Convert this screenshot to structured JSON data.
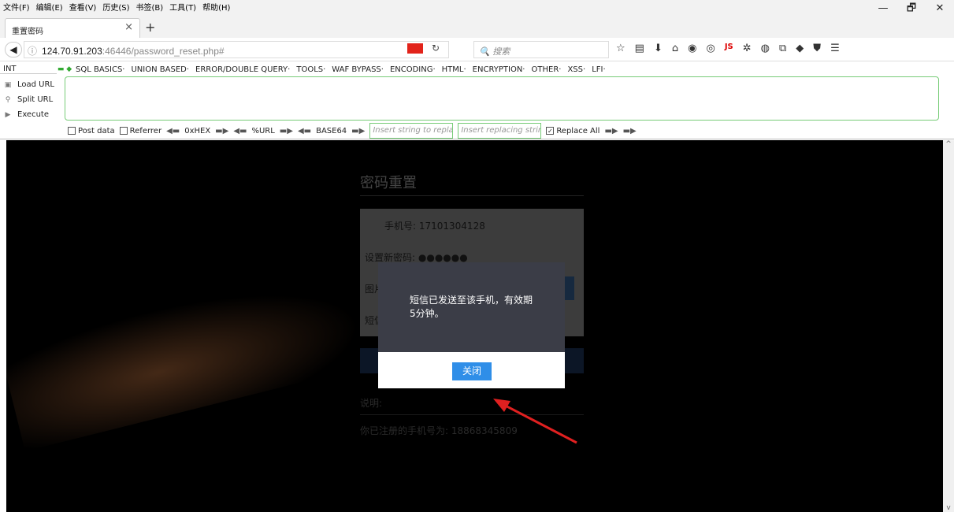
{
  "menubar": {
    "items": [
      "文件(F)",
      "编辑(E)",
      "查看(V)",
      "历史(S)",
      "书签(B)",
      "工具(T)",
      "帮助(H)"
    ],
    "window_controls": {
      "minimize": "—",
      "restore": "🗗",
      "close": "✕"
    }
  },
  "tabbar": {
    "tab_title": "重置密码",
    "close_glyph": "×",
    "new_tab_glyph": "+"
  },
  "navbar": {
    "url_host": "124.70.91.203",
    "url_port_path": ":46446/password_reset.php#",
    "search_placeholder": "搜索",
    "js_label": "JS"
  },
  "hackbar": {
    "select_value": "INT",
    "menu": [
      "SQL BASICS·",
      "UNION BASED·",
      "ERROR/DOUBLE QUERY·",
      "TOOLS·",
      "WAF BYPASS·",
      "ENCODING·",
      "HTML·",
      "ENCRYPTION·",
      "OTHER·",
      "XSS·",
      "LFI·"
    ],
    "side": {
      "load_url": "Load URL",
      "split_url": "Split URL",
      "execute": "Execute"
    },
    "options": {
      "post_data": "Post data",
      "referrer": "Referrer",
      "hex": "0xHEX",
      "url": "%URL",
      "base64": "BASE64",
      "replace_placeholder": "Insert string to replace",
      "replacing_placeholder": "Insert replacing string",
      "replace_all": "Replace All"
    }
  },
  "page": {
    "title": "密码重置",
    "phone_label": "手机号: 17101304128",
    "new_password_label": "设置新密码:",
    "password_mask": "●●●●●●",
    "image_code_label": "图片",
    "sms_code_label": "短信",
    "note_label": "说明:",
    "registered_phone": "你已注册的手机号为: 18868345809"
  },
  "modal": {
    "message": "短信已发送至该手机，有效期5分钟。",
    "close_button": "关闭"
  },
  "colors": {
    "accent_button": "#2f8ee8",
    "modal_bg": "#3b3d47",
    "annotation_arrow": "#e02020",
    "hackbar_border": "#77cc77"
  }
}
